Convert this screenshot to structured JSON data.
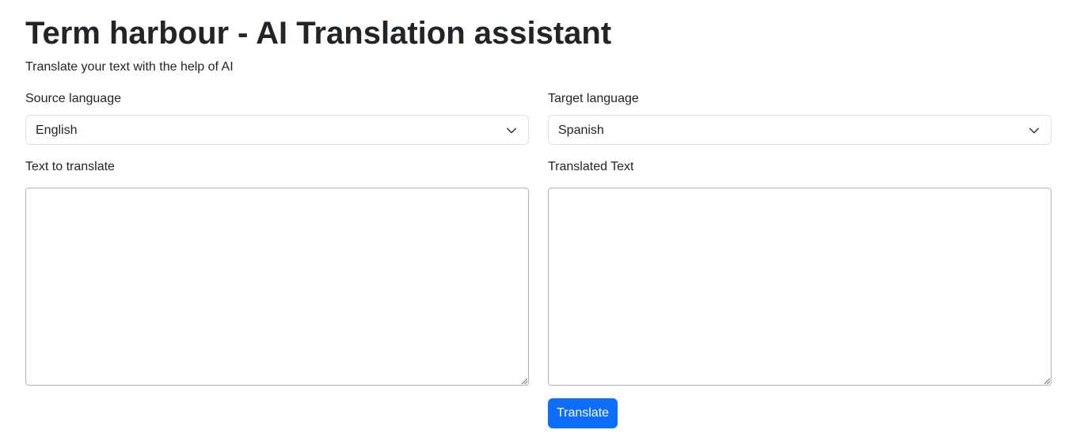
{
  "header": {
    "title": "Term harbour - AI Translation assistant",
    "subtitle": "Translate your text with the help of AI"
  },
  "source": {
    "language_label": "Source language",
    "language_value": "English",
    "text_label": "Text to translate",
    "text_value": ""
  },
  "target": {
    "language_label": "Target language",
    "language_value": "Spanish",
    "text_label": "Translated Text",
    "text_value": ""
  },
  "actions": {
    "translate_label": "Translate"
  },
  "icons": {
    "select_chevron": "chevron-down-icon",
    "textarea_grip": "resize-grip-icon"
  },
  "colors": {
    "primary": "#0d6efd",
    "text": "#212529",
    "border": "#dee2e6"
  }
}
